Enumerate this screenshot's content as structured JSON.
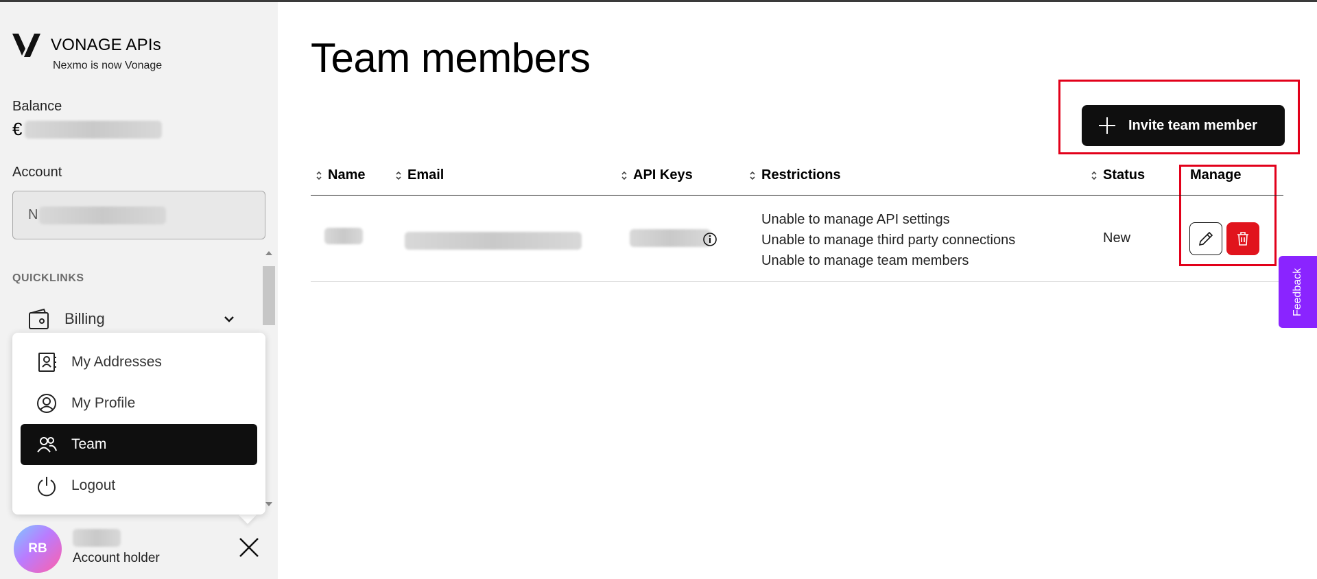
{
  "brand": {
    "name": "VONAGE APIs",
    "subtitle": "Nexmo is now Vonage"
  },
  "sidebar": {
    "balance_label": "Balance",
    "balance_currency": "€",
    "account_label": "Account",
    "account_value_initial": "N",
    "quicklinks_label": "QUICKLINKS",
    "billing": {
      "label": "Billing",
      "icon": "wallet-icon",
      "expand_icon": "chevron-down-icon"
    },
    "menu": [
      {
        "label": "My Addresses",
        "icon": "contact-card-icon",
        "active": false
      },
      {
        "label": "My Profile",
        "icon": "user-circle-icon",
        "active": false
      },
      {
        "label": "Team",
        "icon": "team-icon",
        "active": true
      },
      {
        "label": "Logout",
        "icon": "power-icon",
        "active": false
      }
    ],
    "user": {
      "initials": "RB",
      "role": "Account holder"
    }
  },
  "main": {
    "title": "Team members",
    "invite_button": "Invite team member",
    "table": {
      "columns": [
        "Name",
        "Email",
        "API Keys",
        "Restrictions",
        "Status",
        "Manage"
      ],
      "rows": [
        {
          "restrictions": [
            "Unable to manage API settings",
            "Unable to manage third party connections",
            "Unable to manage team members"
          ],
          "status": "New"
        }
      ]
    }
  },
  "feedback_tab": "Feedback",
  "colors": {
    "accent": "#0f0f0f",
    "danger": "#e1141d",
    "highlight": "#e2001a",
    "feedback": "#8a24ff"
  }
}
